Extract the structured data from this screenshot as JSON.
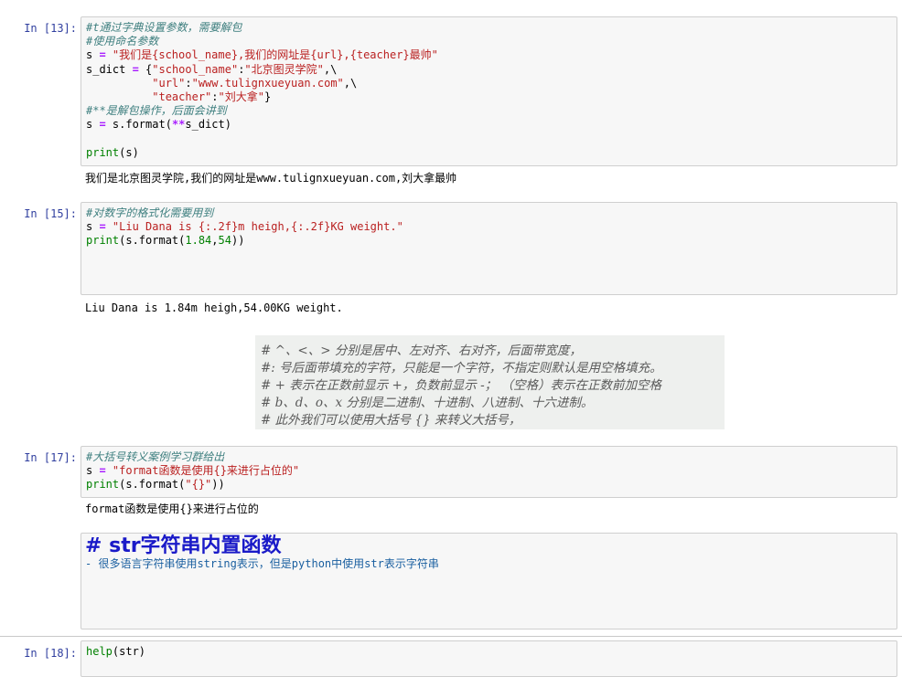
{
  "cells": [
    {
      "prompt": "In  [13]:",
      "lines": [
        {
          "segs": [
            [
              "cm",
              "#t通过字典设置参数，需要解包"
            ]
          ]
        },
        {
          "segs": [
            [
              "cm",
              "#使用命名参数"
            ]
          ]
        },
        {
          "segs": [
            [
              "",
              "s "
            ],
            [
              "op",
              "="
            ],
            [
              "st",
              " \"我们是{school_name},我们的网址是{url},{teacher}最帅\""
            ]
          ]
        },
        {
          "segs": [
            [
              "",
              "s_dict "
            ],
            [
              "op",
              "="
            ],
            [
              "",
              " {"
            ],
            [
              "st",
              "\"school_name\""
            ],
            [
              "",
              ":"
            ],
            [
              "st",
              "\"北京图灵学院\""
            ],
            [
              "",
              ",\\"
            ]
          ]
        },
        {
          "segs": [
            [
              "",
              "          "
            ],
            [
              "st",
              "\"url\""
            ],
            [
              "",
              ":"
            ],
            [
              "st",
              "\"www.tulignxueyuan.com\""
            ],
            [
              "",
              ",\\"
            ]
          ]
        },
        {
          "segs": [
            [
              "",
              "          "
            ],
            [
              "st",
              "\"teacher\""
            ],
            [
              "",
              ":"
            ],
            [
              "st",
              "\"刘大拿\""
            ],
            [
              "",
              "}"
            ]
          ]
        },
        {
          "segs": [
            [
              "cm",
              "#**是解包操作，后面会讲到"
            ]
          ]
        },
        {
          "segs": [
            [
              "",
              "s "
            ],
            [
              "op",
              "="
            ],
            [
              "",
              " s.format("
            ],
            [
              "op",
              "**"
            ],
            [
              "",
              "s_dict)"
            ]
          ]
        },
        {
          "segs": [
            [
              "",
              ""
            ]
          ]
        },
        {
          "segs": [
            [
              "kw",
              "print"
            ],
            [
              "",
              "(s)"
            ]
          ]
        }
      ],
      "output": "我们是北京图灵学院,我们的网址是www.tulignxueyuan.com,刘大拿最帅"
    },
    {
      "prompt": "In  [15]:",
      "lines": [
        {
          "segs": [
            [
              "cm",
              "#对数字的格式化需要用到"
            ]
          ]
        },
        {
          "segs": [
            [
              "",
              "s "
            ],
            [
              "op",
              "="
            ],
            [
              "st",
              " \"Liu Dana is {:.2f}m heigh,{:.2f}KG weight.\""
            ]
          ]
        },
        {
          "segs": [
            [
              "kw",
              "print"
            ],
            [
              "",
              "(s.format("
            ],
            [
              "num",
              "1.84"
            ],
            [
              "",
              ","
            ],
            [
              "num",
              "54"
            ],
            [
              "",
              "))"
            ]
          ]
        }
      ],
      "output": "Liu Dana is 1.84m heigh,54.00KG weight."
    },
    {
      "prompt": "In  [17]:",
      "lines": [
        {
          "segs": [
            [
              "cm",
              "#大括号转义案例学习群给出"
            ]
          ]
        },
        {
          "segs": [
            [
              "",
              "s "
            ],
            [
              "op",
              "="
            ],
            [
              "st",
              " \"format函数是使用{}来进行占位的\""
            ]
          ]
        },
        {
          "segs": [
            [
              "kw",
              "print"
            ],
            [
              "",
              "(s.format("
            ],
            [
              "st",
              "\"{}\""
            ],
            [
              "",
              "))"
            ]
          ]
        }
      ],
      "output": "format函数是使用{}来进行占位的"
    },
    {
      "prompt": "In  [18]:",
      "lines": [
        {
          "segs": [
            [
              "kw",
              "help"
            ],
            [
              "",
              "(str)"
            ]
          ]
        }
      ]
    }
  ],
  "image_text": [
    "#  ^、<、> 分别是居中、左对齐、右对齐，后面带宽度，",
    "#: 号后面带填充的字符，只能是一个字符，不指定则默认是用空格填充。",
    "# + 表示在正数前显示 +，负数前显示 -；  （空格）表示在正数前加空格",
    "# b、d、o、x 分别是二进制、十进制、八进制、十六进制。",
    "# 此外我们可以使用大括号 {} 来转义大括号，"
  ],
  "markdown": {
    "heading": "#  str字符串内置函数",
    "item": "- 很多语言字符串使用string表示，但是python中使用str表示字符串"
  }
}
